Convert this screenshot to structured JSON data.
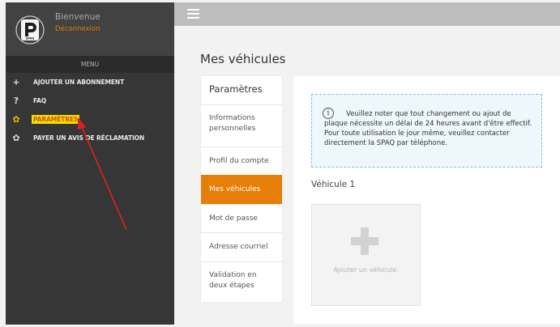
{
  "sidebar": {
    "logo_text": "SPAQ",
    "welcome": "Bienvenue",
    "logout": "Déconnexion",
    "menu_title": "MENU",
    "items": [
      {
        "label": "AJOUTER UN ABONNEMENT",
        "icon": "plus-icon"
      },
      {
        "label": "FAQ",
        "icon": "question-icon"
      },
      {
        "label": "PARAMÈTRES",
        "icon": "gear-icon",
        "active": true
      },
      {
        "label": "PAYER UN AVIS DE RÉCLAMATION",
        "icon": "gear-icon"
      }
    ]
  },
  "page": {
    "title": "Mes véhicules"
  },
  "settings": {
    "title": "Paramètres",
    "items": [
      {
        "label": "Informations personnelles"
      },
      {
        "label": "Profil du compte"
      },
      {
        "label": "Mes véhicules",
        "active": true
      },
      {
        "label": "Mot de passe"
      },
      {
        "label": "Adresse courriel"
      },
      {
        "label": "Validation en deux étapes"
      }
    ]
  },
  "content": {
    "notice": "Veuillez noter que tout changement ou ajout de plaque nécessite un délai de 24 heures avant d'être effectif. Pour toute utilisation le jour même, veuillez contacter directement la SPAQ par téléphone.",
    "vehicle_title": "Véhicule 1",
    "add_vehicle": "Ajouter un véhicule."
  },
  "colors": {
    "accent": "#e67e07",
    "highlight": "#e8e400",
    "annotation_arrow": "#e02020"
  }
}
